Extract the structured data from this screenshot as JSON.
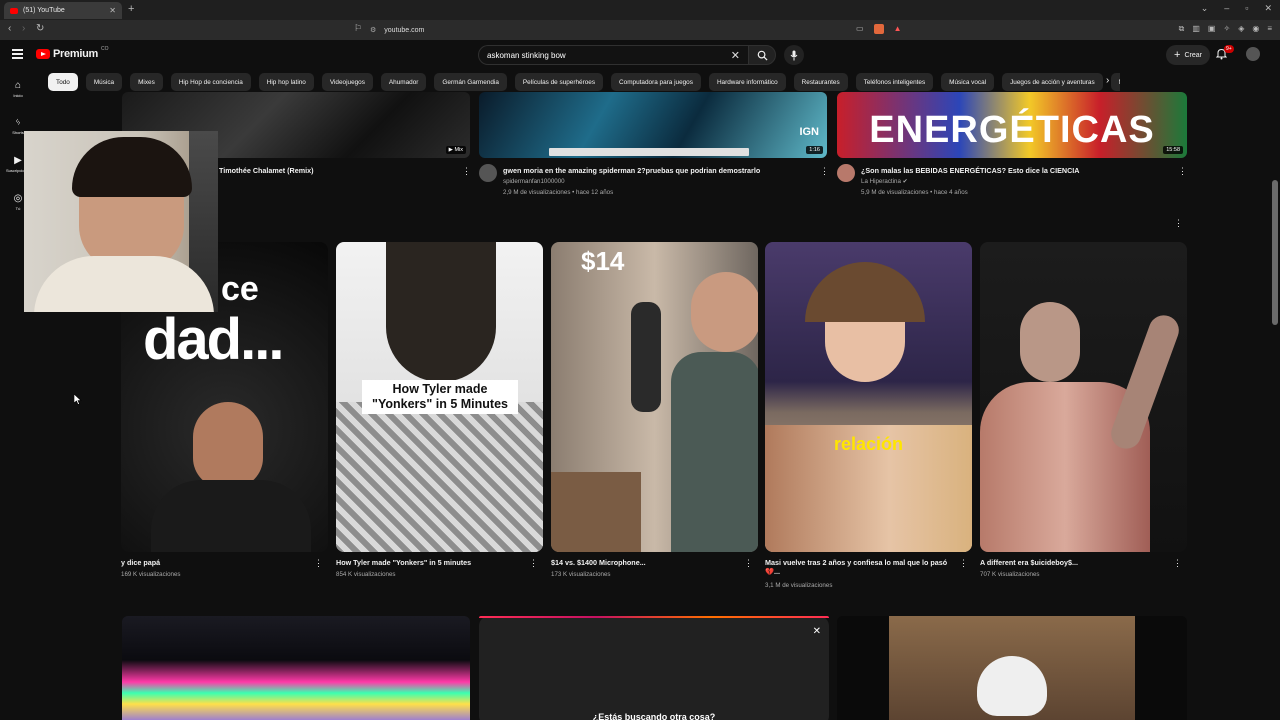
{
  "browser": {
    "tab_title": "(51) YouTube",
    "url": "youtube.com"
  },
  "header": {
    "logo_text": "Premium",
    "logo_sup": "CO",
    "search_value": "askoman stinking bow",
    "create_label": "Crear",
    "notification_count": "9+"
  },
  "guide": {
    "items": [
      {
        "label": "Inicio",
        "icon": "home-icon"
      },
      {
        "label": "Shorts",
        "icon": "shorts-icon"
      },
      {
        "label": "Suscripciones",
        "icon": "subscriptions-icon"
      },
      {
        "label": "Tú",
        "icon": "you-icon"
      }
    ]
  },
  "chips": [
    "Todo",
    "Música",
    "Mixes",
    "Hip Hop de conciencia",
    "Hip hop latino",
    "Videojuegos",
    "Ahumador",
    "Germán Garmendia",
    "Películas de superhéroes",
    "Computadora para juegos",
    "Hardware informático",
    "Restaurantes",
    "Teléfonos inteligentes",
    "Música vocal",
    "Juegos de acción y aventuras",
    "M"
  ],
  "top_row": [
    {
      "title": "Timothée Chalamet (Remix)",
      "badge": "Mix"
    },
    {
      "title": "gwen moria en the amazing spiderman 2?pruebas que podrian demostrarlo",
      "channel": "spidermanfan1000000",
      "meta": "2,9 M de visualizaciones • hace 12 años",
      "duration": "1:16",
      "thumb_text": "IGN"
    },
    {
      "title": "¿Son malas las BEBIDAS ENERGÉTICAS? Esto dice la CIENCIA",
      "channel": "La Hiperactina",
      "meta": "5,9 M de visualizaciones • hace 4 años",
      "duration": "15:58",
      "thumb_text": "ENERGÉTICAS"
    }
  ],
  "shorts": [
    {
      "title": "y dice papá",
      "views": "169 K visualizaciones",
      "thumb_text": "dad...",
      "thumb_text2": "ce"
    },
    {
      "title": "How Tyler made \"Yonkers\" in 5 minutes",
      "views": "854 K visualizaciones",
      "thumb_text": "How Tyler made \"Yonkers\" in 5 Minutes"
    },
    {
      "title": "$14 vs. $1400 Microphone...",
      "views": "173 K visualizaciones",
      "thumb_text": "$14"
    },
    {
      "title": "Masi vuelve tras 2 años y confiesa lo mal que lo pasó 💔...",
      "views": "3,1 M de visualizaciones",
      "thumb_text": "relación"
    },
    {
      "title": "A different era $uicideboy$...",
      "views": "707 K visualizaciones"
    }
  ],
  "popup": {
    "text": "¿Estás buscando otra cosa?"
  },
  "colors": {
    "background": "#0f0f0f",
    "brand_red": "#ff0000",
    "text_primary": "#f1f1f1",
    "text_secondary": "#aaaaaa"
  }
}
